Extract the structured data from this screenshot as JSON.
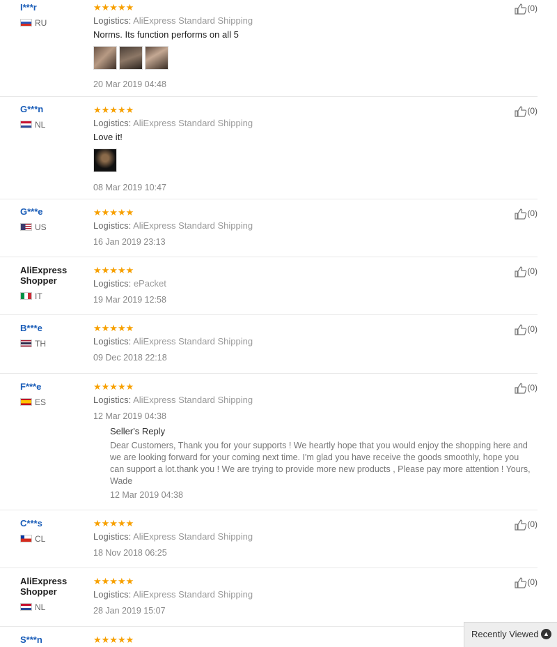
{
  "reviews": [
    {
      "user": "I***r",
      "country": "RU",
      "rating": "★★★★★",
      "logistics_label": "Logistics:",
      "logistics": "AliExpress Standard Shipping",
      "text": "Norms. Its function performs on all 5",
      "photos": 3,
      "date": "20 Mar 2019 04:48",
      "likes": "(0)"
    },
    {
      "user": "G***n",
      "country": "NL",
      "rating": "★★★★★",
      "logistics_label": "Logistics:",
      "logistics": "AliExpress Standard Shipping",
      "text": "Love it!",
      "photos": 1,
      "date": "08 Mar 2019 10:47",
      "likes": "(0)"
    },
    {
      "user": "G***e",
      "country": "US",
      "rating": "★★★★★",
      "logistics_label": "Logistics:",
      "logistics": "AliExpress Standard Shipping",
      "date": "16 Jan 2019 23:13",
      "likes": "(0)"
    },
    {
      "user": "AliExpress Shopper",
      "country": "IT",
      "rating": "★★★★★",
      "logistics_label": "Logistics:",
      "logistics": "ePacket",
      "date": "19 Mar 2019 12:58",
      "likes": "(0)"
    },
    {
      "user": "B***e",
      "country": "TH",
      "rating": "★★★★★",
      "logistics_label": "Logistics:",
      "logistics": "AliExpress Standard Shipping",
      "date": "09 Dec 2018 22:18",
      "likes": "(0)"
    },
    {
      "user": "F***e",
      "country": "ES",
      "rating": "★★★★★",
      "logistics_label": "Logistics:",
      "logistics": "AliExpress Standard Shipping",
      "date": "12 Mar 2019 04:38",
      "likes": "(0)",
      "seller_reply": {
        "title": "Seller's Reply",
        "text": "Dear Customers, Thank you for your supports ! We heartly hope that you would enjoy the shopping here and we are looking forward for your coming next time. I'm glad you have receive the goods smoothly, hope you can support a lot.thank you ! We are trying to provide more new products , Please pay more attention ! Yours, Wade",
        "date": "12 Mar 2019 04:38"
      }
    },
    {
      "user": "C***s",
      "country": "CL",
      "rating": "★★★★★",
      "logistics_label": "Logistics:",
      "logistics": "AliExpress Standard Shipping",
      "date": "18 Nov 2018 06:25",
      "likes": "(0)"
    },
    {
      "user": "AliExpress Shopper",
      "country": "NL",
      "rating": "★★★★★",
      "logistics_label": "Logistics:",
      "logistics": "AliExpress Standard Shipping",
      "date": "28 Jan 2019 15:07",
      "likes": "(0)"
    },
    {
      "user": "S***n",
      "rating": "★★★★★"
    }
  ],
  "recently_viewed": {
    "label": "Recently Viewed",
    "icon": "chevron-up-icon"
  }
}
